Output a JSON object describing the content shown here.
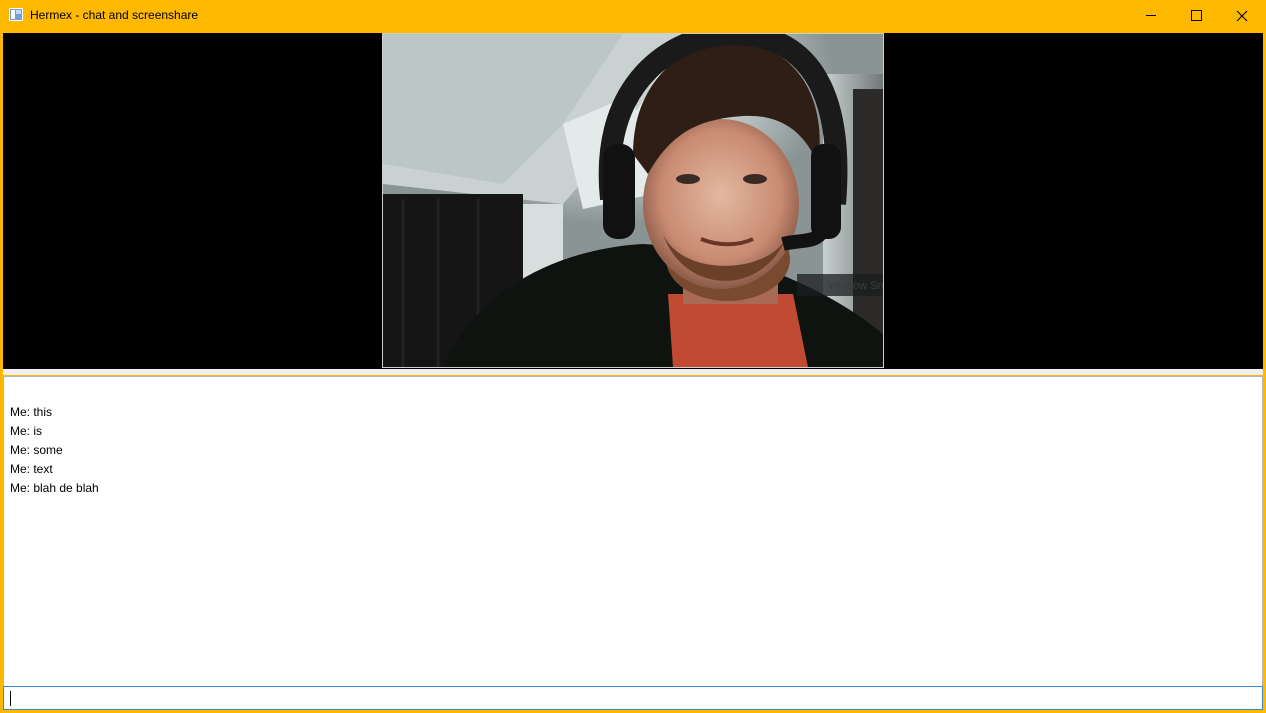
{
  "window": {
    "title": "Hermex - chat and screenshare",
    "accent_color": "#ffb900",
    "icon": "app-window-icon",
    "controls": {
      "minimize_icon": "minimize-icon",
      "maximize_icon": "maximize-icon",
      "close_icon": "close-icon"
    }
  },
  "video": {
    "overlay_label": "Window Snip"
  },
  "chat": {
    "messages": [
      "Me: this",
      "Me: is",
      "Me: some",
      "Me: text",
      "Me: blah de blah"
    ]
  },
  "input": {
    "value": ""
  }
}
